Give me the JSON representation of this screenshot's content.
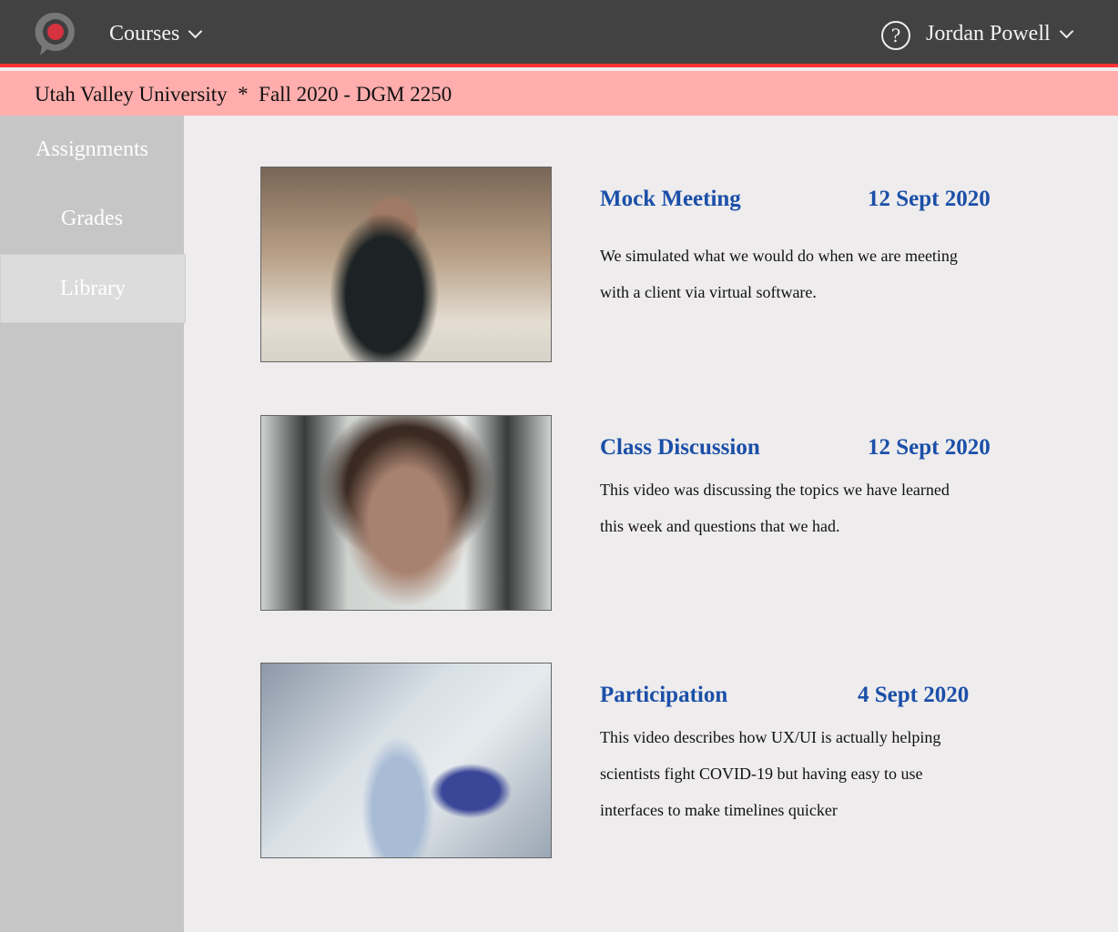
{
  "header": {
    "courses_label": "Courses",
    "user_name": "Jordan Powell",
    "help_symbol": "?"
  },
  "subheader": {
    "text": "Utah Valley University  *  Fall 2020 - DGM 2250"
  },
  "sidebar": {
    "items": [
      {
        "label": "Assignments"
      },
      {
        "label": "Grades"
      },
      {
        "label": "Library"
      }
    ]
  },
  "videos": [
    {
      "title": "Mock Meeting",
      "date": "12 Sept 2020",
      "line1": "We simulated what we would do when we are meeting",
      "line2": "with a client via virtual software."
    },
    {
      "title": "Class Discussion",
      "date": "12 Sept 2020",
      "line1": "This video was discussing the topics we have learned",
      "line2": "this week and questions that we had."
    },
    {
      "title": "Participation",
      "date": "4 Sept 2020",
      "line1": "This video describes how UX/UI is actually helping",
      "line2": "scientists fight COVID-19 but having easy to use",
      "line3": "interfaces to make timelines quicker"
    }
  ],
  "colors": {
    "accent": "#ff3333",
    "title": "#1b4fa8",
    "subheader": "#ffadad"
  }
}
